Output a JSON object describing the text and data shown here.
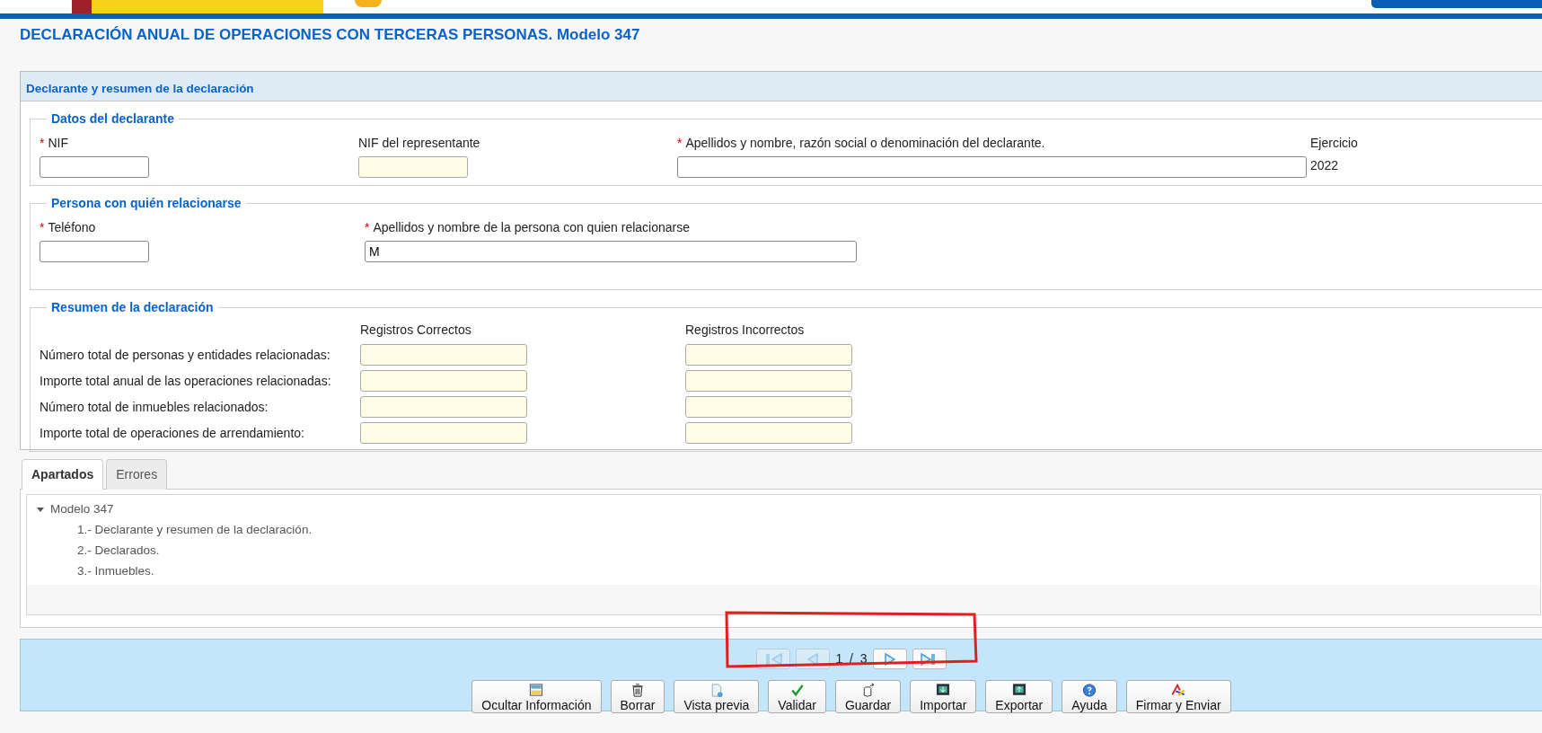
{
  "title": "DECLARACIÓN ANUAL DE OPERACIONES CON TERCERAS PERSONAS. Modelo 347",
  "panel": {
    "title": "Declarante y resumen de la declaración",
    "declarante": {
      "legend": "Datos del declarante",
      "fields": [
        {
          "label": "NIF",
          "required_mark": "*",
          "readonly": false
        },
        {
          "label": "NIF del representante",
          "readonly": true
        },
        {
          "label": "Apellidos y nombre, razón social o denominación del declarante.",
          "required_mark": "*",
          "readonly": false
        }
      ],
      "ejercicio": {
        "label": "Ejercicio",
        "value": "2022"
      }
    },
    "persona": {
      "legend": "Persona con quién relacionarse",
      "fields": [
        {
          "label": "Teléfono",
          "required_mark": "*",
          "readonly": false
        },
        {
          "label": "Apellidos y nombre de la persona con quien relacionarse",
          "required_mark": "*",
          "readonly": false,
          "value": "M"
        }
      ]
    },
    "resumen": {
      "legend": "Resumen de la declaración",
      "columns": [
        "Registros Correctos",
        "Registros Incorrectos"
      ],
      "rows": [
        {
          "label": "Número total de personas y entidades relacionadas:"
        },
        {
          "label": "Importe total anual de las operaciones relacionadas:"
        },
        {
          "label": "Número total de inmuebles relacionados:"
        },
        {
          "label": "Importe total de operaciones de arrendamiento:"
        }
      ]
    }
  },
  "tabs": [
    {
      "label": "Apartados",
      "selected": true
    },
    {
      "label": "Errores",
      "selected": false
    }
  ],
  "tree": [
    {
      "label": "Modelo 347",
      "expanded": true,
      "children": [
        {
          "label": "1.- Declarante y resumen de la declaración."
        },
        {
          "label": "2.- Declarados."
        },
        {
          "label": "3.- Inmuebles."
        }
      ]
    }
  ],
  "pager": {
    "buttons": [
      {
        "kind": "first",
        "disabled": true
      },
      {
        "kind": "prev",
        "disabled": true
      },
      {
        "kind": "next",
        "disabled": false
      },
      {
        "kind": "last",
        "disabled": false
      }
    ],
    "page": "1",
    "separator": "/",
    "total": "3"
  },
  "actions": [
    {
      "kind": "info",
      "label": "Ocultar Información"
    },
    {
      "kind": "delete",
      "label": "Borrar"
    },
    {
      "kind": "preview",
      "label": "Vista previa"
    },
    {
      "kind": "validate",
      "label": "Validar"
    },
    {
      "kind": "save",
      "label": "Guardar"
    },
    {
      "kind": "import",
      "label": "Importar"
    },
    {
      "kind": "export",
      "label": "Exportar"
    },
    {
      "kind": "help",
      "label": "Ayuda"
    },
    {
      "kind": "sign",
      "label": "Firmar y Enviar"
    }
  ]
}
